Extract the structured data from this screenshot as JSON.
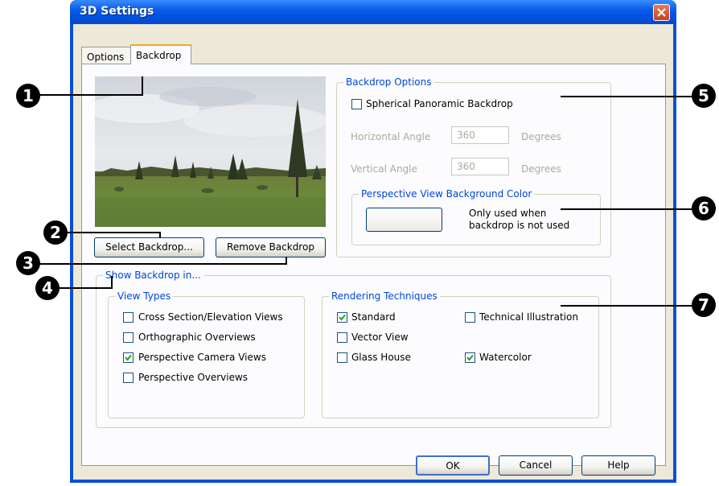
{
  "window": {
    "title": "3D Settings"
  },
  "tabs": [
    "Options",
    "Backdrop"
  ],
  "preview": {
    "buttons": {
      "select": "Select Backdrop...",
      "remove": "Remove Backdrop"
    }
  },
  "backdrop_options": {
    "legend": "Backdrop Options",
    "spherical_label": "Spherical Panoramic Backdrop",
    "spherical_checked": false,
    "horizontal_label": "Horizontal Angle",
    "horizontal_value": "360",
    "vertical_label": "Vertical Angle",
    "vertical_value": "360",
    "unit": "Degrees"
  },
  "perspective_color": {
    "legend": "Perspective View Background Color",
    "note_line1": "Only used when",
    "note_line2": "backdrop is not used"
  },
  "show_backdrop": {
    "legend": "Show Backdrop in...",
    "view_types": {
      "legend": "View Types",
      "items": [
        {
          "label": "Cross Section/Elevation Views",
          "checked": false
        },
        {
          "label": "Orthographic Overviews",
          "checked": false
        },
        {
          "label": "Perspective Camera Views",
          "checked": true
        },
        {
          "label": "Perspective Overviews",
          "checked": false
        }
      ]
    },
    "rendering": {
      "legend": "Rendering Techniques",
      "items": [
        {
          "label": "Standard",
          "checked": true
        },
        {
          "label": "Vector View",
          "checked": false
        },
        {
          "label": "Glass House",
          "checked": false
        },
        {
          "label": "Technical Illustration",
          "checked": false
        },
        {
          "label": "Watercolor",
          "checked": true
        }
      ]
    }
  },
  "footer": {
    "ok": "OK",
    "cancel": "Cancel",
    "help": "Help"
  },
  "callouts": [
    "1",
    "2",
    "3",
    "4",
    "5",
    "6",
    "7"
  ],
  "colors": {
    "title_blue": "#0a5ce8",
    "group_legend": "#0046d5",
    "face": "#ece9d8",
    "check_green": "#21a121"
  }
}
